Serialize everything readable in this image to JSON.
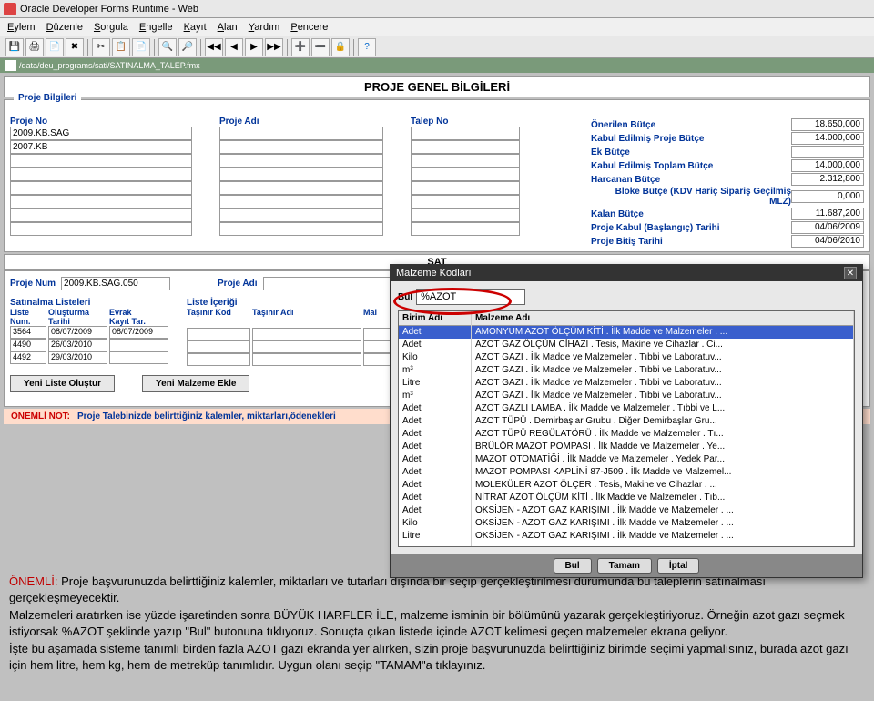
{
  "window": {
    "title": "Oracle Developer Forms Runtime - Web"
  },
  "menu": {
    "items": [
      "Eylem",
      "Düzenle",
      "Sorgula",
      "Engelle",
      "Kayıt",
      "Alan",
      "Yardım",
      "Pencere"
    ]
  },
  "pathbar": {
    "text": "/data/deu_programs/sati/SATINALMA_TALEP.fmx"
  },
  "panel_title": "PROJE GENEL BİLGİLERİ",
  "proje_bilgileri": {
    "title": "Proje Bilgileri",
    "lbl_no": "Proje No",
    "lbl_adi": "Proje Adı",
    "lbl_talep": "Talep No",
    "rows": [
      {
        "no": "2009.KB.SAG",
        "adi": "",
        "talep": ""
      },
      {
        "no": "2007.KB",
        "adi": "",
        "talep": ""
      }
    ]
  },
  "budget": {
    "labels": {
      "onerilen": "Önerilen Bütçe",
      "kabul_proje": "Kabul Edilmiş Proje Bütçe",
      "ek": "Ek Bütçe",
      "kabul_toplam": "Kabul Edilmiş Toplam Bütçe",
      "harcanan": "Harcanan Bütçe",
      "bloke": "Bloke Bütçe (KDV Hariç Sipariş Geçilmiş MLZ)",
      "kalan": "Kalan Bütçe",
      "baslangic": "Proje Kabul (Başlangıç) Tarihi",
      "bitis": "Proje Bitiş Tarihi"
    },
    "values": {
      "onerilen": "18.650,000",
      "kabul_proje": "14.000,000",
      "ek": "",
      "kabul_toplam": "14.000,000",
      "harcanan": "2.312,800",
      "bloke": "0,000",
      "kalan": "11.687,200",
      "baslangic": "04/06/2009",
      "bitis": "04/06/2010"
    }
  },
  "sat_header": "SAT",
  "sat": {
    "lbl_num": "Proje Num",
    "lbl_adi": "Proje Adı",
    "num_val": "2009.KB.SAG.050"
  },
  "lists": {
    "sat_list_title": "Satınalma Listeleri",
    "icerik_title": "Liste İçeriği",
    "cols": {
      "liste_num": "Liste\nNum.",
      "olusturma": "Oluşturma\nTarihi",
      "evrak": "Evrak\nKayıt Tar.",
      "tasinir_kod": "Taşınır Kod",
      "tasinir_adi": "Taşınır Adı",
      "mal": "Mal"
    },
    "rows": [
      {
        "num": "3564",
        "olusturma": "08/07/2009",
        "evrak": "08/07/2009"
      },
      {
        "num": "4490",
        "olusturma": "26/03/2010",
        "evrak": ""
      },
      {
        "num": "4492",
        "olusturma": "29/03/2010",
        "evrak": ""
      }
    ]
  },
  "buttons": {
    "yeni_liste": "Yeni Liste Oluştur",
    "yeni_malzeme": "Yeni Malzeme Ekle"
  },
  "note": {
    "label": "ÖNEMLİ NOT:",
    "text": "Proje Talebinizde belirttiğiniz kalemler, miktarları,ödenekleri"
  },
  "dialog": {
    "title": "Malzeme Kodları",
    "search_lbl": "Bul",
    "search_val": "%AZOT",
    "col_birim": "Birim Adı",
    "col_malz": "Malzeme Adı",
    "rows": [
      {
        "birim": "Adet",
        "malz": "AMONYUM AZOT ÖLÇÜM KİTİ .  İlk Madde ve Malzemeler . ...",
        "sel": true
      },
      {
        "birim": "Adet",
        "malz": "AZOT GAZ ÖLÇÜM CİHAZI .  Tesis, Makine ve Cihazlar .  Ci..."
      },
      {
        "birim": "Kilo",
        "malz": "AZOT GAZI .  İlk Madde ve Malzemeler .  Tıbbi ve Laboratuv..."
      },
      {
        "birim": "m³",
        "malz": "AZOT GAZI .  İlk Madde ve Malzemeler .  Tıbbi ve Laboratuv..."
      },
      {
        "birim": "Litre",
        "malz": "AZOT GAZI .  İlk Madde ve Malzemeler .  Tıbbi ve Laboratuv..."
      },
      {
        "birim": "m³",
        "malz": "AZOT GAZI .  İlk Madde ve Malzemeler .  Tıbbi ve Laboratuv..."
      },
      {
        "birim": "Adet",
        "malz": "AZOT GAZLI LAMBA .  İlk Madde ve Malzemeler .  Tıbbi ve L..."
      },
      {
        "birim": "Adet",
        "malz": "AZOT TÜPÜ .  Demirbaşlar Grubu .  Diğer Demirbaşlar Gru..."
      },
      {
        "birim": "Adet",
        "malz": "AZOT TÜPÜ REGÜLATÖRÜ .  İlk Madde ve Malzemeler .  Tı..."
      },
      {
        "birim": "Adet",
        "malz": "BRÜLÖR MAZOT POMPASI .  İlk Madde ve Malzemeler .  Ye..."
      },
      {
        "birim": "Adet",
        "malz": "MAZOT OTOMATİĞİ .  İlk Madde ve Malzemeler .  Yedek Par..."
      },
      {
        "birim": "Adet",
        "malz": "MAZOT POMPASI KAPLİNİ 87-J509 .  İlk Madde ve Malzemel..."
      },
      {
        "birim": "Adet",
        "malz": "MOLEKÜLER AZOT ÖLÇER .  Tesis, Makine ve Cihazlar .  ..."
      },
      {
        "birim": "Adet",
        "malz": "NİTRAT AZOT ÖLÇÜM KİTİ .  İlk Madde ve Malzemeler .  Tıb..."
      },
      {
        "birim": "Adet",
        "malz": "OKSİJEN - AZOT GAZ KARIŞIMI .  İlk Madde ve Malzemeler .  ..."
      },
      {
        "birim": "Kilo",
        "malz": "OKSİJEN - AZOT GAZ KARIŞIMI .  İlk Madde ve Malzemeler .  ..."
      },
      {
        "birim": "Litre",
        "malz": "OKSİJEN - AZOT GAZ KARIŞIMI .  İlk Madde ve Malzemeler .  ..."
      }
    ],
    "btn_bul": "Bul",
    "btn_tamam": "Tamam",
    "btn_iptal": "İptal"
  },
  "instructions": {
    "l1a": "ÖNEMLİ: ",
    "l1b": "Proje başvurunuzda belirttiğiniz kalemler, miktarları ve tutarları dışında bir seçip gerçekleştirilmesi durumunda bu taleplerin satınalması gerçekleşmeyecektir.",
    "l2": "Malzemeleri aratırken ise yüzde işaretinden sonra BÜYÜK HARFLER İLE, malzeme isminin bir bölümünü yazarak gerçekleştiriyoruz. Örneğin azot gazı seçmek istiyorsak %AZOT şeklinde yazıp \"Bul\" butonuna tıklıyoruz. Sonuçta çıkan listede içinde AZOT kelimesi geçen malzemeler ekrana geliyor.",
    "l3": "İşte bu aşamada sisteme tanımlı birden fazla AZOT gazı ekranda yer alırken, sizin proje başvurunuzda belirttiğiniz birimde seçimi yapmalısınız, burada azot gazı için hem litre, hem kg, hem de metreküp tanımlıdır. Uygun olanı seçip \"TAMAM\"a tıklayınız."
  }
}
